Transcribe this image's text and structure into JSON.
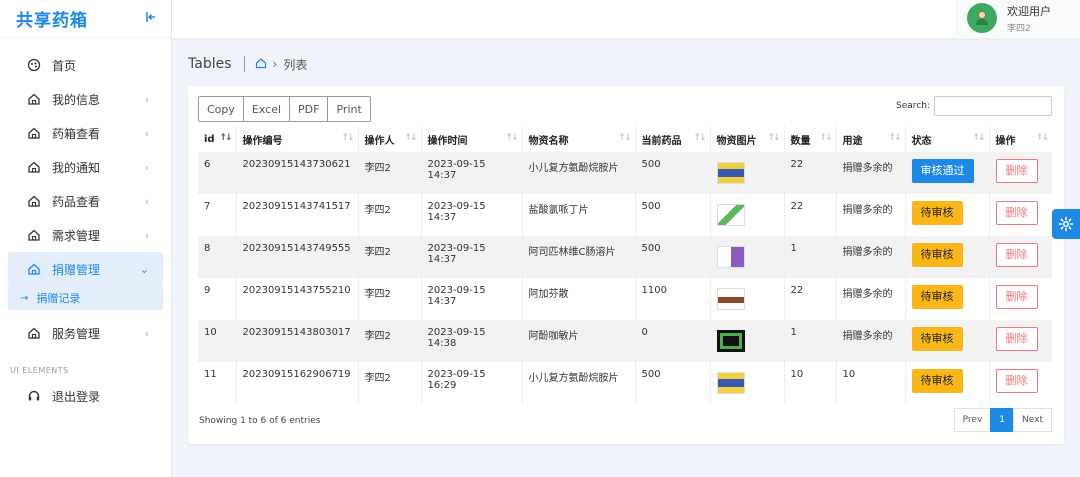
{
  "sidebar": {
    "brand": "共享药箱",
    "items": [
      {
        "label": "首页"
      },
      {
        "label": "我的信息"
      },
      {
        "label": "药箱查看"
      },
      {
        "label": "我的通知"
      },
      {
        "label": "药品查看"
      },
      {
        "label": "需求管理"
      },
      {
        "label": "捐赠管理"
      },
      {
        "label": "服务管理"
      }
    ],
    "sub_item": "捐赠记录",
    "section_label": "UI ELEMENTS",
    "logout": "退出登录"
  },
  "user": {
    "welcome": "欢迎用户",
    "name": "李四2"
  },
  "page": {
    "title": "Tables",
    "crumb": "列表"
  },
  "toolbar": {
    "copy": "Copy",
    "excel": "Excel",
    "pdf": "PDF",
    "print": "Print"
  },
  "search": {
    "label": "Search:",
    "value": ""
  },
  "table": {
    "headers": [
      "id",
      "操作编号",
      "操作人",
      "操作时间",
      "物资名称",
      "当前药品",
      "物资图片",
      "数量",
      "用途",
      "状态",
      "操作"
    ],
    "rows": [
      {
        "id": "6",
        "code": "20230915143730621",
        "operator": "李四2",
        "time": "2023-09-15 14:37",
        "name": "小儿复方氨酚烷胺片",
        "stock": "500",
        "qty": "22",
        "usage": "捐赠多余的",
        "status": "审核通过",
        "action": "删除"
      },
      {
        "id": "7",
        "code": "20230915143741517",
        "operator": "李四2",
        "time": "2023-09-15 14:37",
        "name": "盐酸氯哌丁片",
        "stock": "500",
        "qty": "22",
        "usage": "捐赠多余的",
        "status": "待审核",
        "action": "删除"
      },
      {
        "id": "8",
        "code": "20230915143749555",
        "operator": "李四2",
        "time": "2023-09-15 14:37",
        "name": "阿司匹林维C肠溶片",
        "stock": "500",
        "qty": "1",
        "usage": "捐赠多余的",
        "status": "待审核",
        "action": "删除"
      },
      {
        "id": "9",
        "code": "20230915143755210",
        "operator": "李四2",
        "time": "2023-09-15 14:37",
        "name": "阿加芬散",
        "stock": "1100",
        "qty": "22",
        "usage": "捐赠多余的",
        "status": "待审核",
        "action": "删除"
      },
      {
        "id": "10",
        "code": "20230915143803017",
        "operator": "李四2",
        "time": "2023-09-15 14:38",
        "name": "阿酚咖敏片",
        "stock": "0",
        "qty": "1",
        "usage": "捐赠多余的",
        "status": "待审核",
        "action": "删除"
      },
      {
        "id": "11",
        "code": "20230915162906719",
        "operator": "李四2",
        "time": "2023-09-15 16:29",
        "name": "小儿复方氨酚烷胺片",
        "stock": "500",
        "qty": "10",
        "usage": "10",
        "status": "待审核",
        "action": "删除"
      }
    ]
  },
  "footer": {
    "info": "Showing 1 to 6 of 6 entries",
    "prev": "Prev",
    "page": "1",
    "next": "Next"
  },
  "colors": {
    "accent": "#1e88e5",
    "pending": "#f9b818",
    "danger": "#e77777"
  }
}
